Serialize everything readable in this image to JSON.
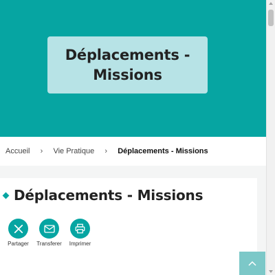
{
  "hero": {
    "title": "Déplacements -\nMissions"
  },
  "breadcrumb": {
    "items": [
      {
        "label": "Accueil"
      },
      {
        "label": "Vie Pratique"
      },
      {
        "label": "Déplacements - Missions"
      }
    ],
    "separator": "›"
  },
  "main": {
    "heading": "Déplacements - Missions"
  },
  "share": {
    "items": [
      {
        "label": "Partager",
        "icon": "x-logo-icon"
      },
      {
        "label": "Transferer",
        "icon": "mail-icon"
      },
      {
        "label": "Imprimer",
        "icon": "printer-icon"
      }
    ]
  },
  "colors": {
    "accent": "#06a5a2",
    "hero_card": "#b7e3e6",
    "scroll_top_button": "#7cc8c8"
  },
  "icons": {
    "scroll_top": "chevron-up-icon"
  }
}
